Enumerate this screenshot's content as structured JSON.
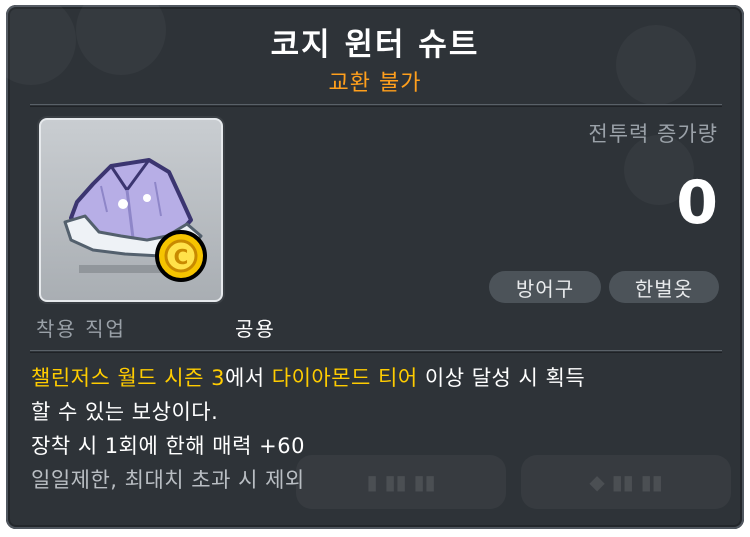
{
  "item": {
    "name": "코지 윈터 슈트",
    "trade_status": "교환 불가",
    "icon": "winter-suit-icon",
    "coin_icon": "gold-coin-icon"
  },
  "combat_power": {
    "label": "전투력 증가량",
    "value": "0"
  },
  "tags": [
    "방어구",
    "한벌옷"
  ],
  "job": {
    "label": "착용 직업",
    "value": "공용"
  },
  "description": {
    "seg1": "챌린저스 월드 시즌 3",
    "seg2": "에서 ",
    "seg3": "다이아몬드 티어",
    "seg4": " 이상 달성 시 획득",
    "seg5": "할 수 있는 보상이다.",
    "line3": "장착 시 1회에 한해 매력 +60",
    "line4": "일일제한, 최대치 초과 시 제외"
  },
  "colors": {
    "background": "#2e3338",
    "title": "#ffffff",
    "trade_status": "#ff9f1c",
    "highlight": "#ffcc00",
    "tag_bg": "#4c5359"
  }
}
